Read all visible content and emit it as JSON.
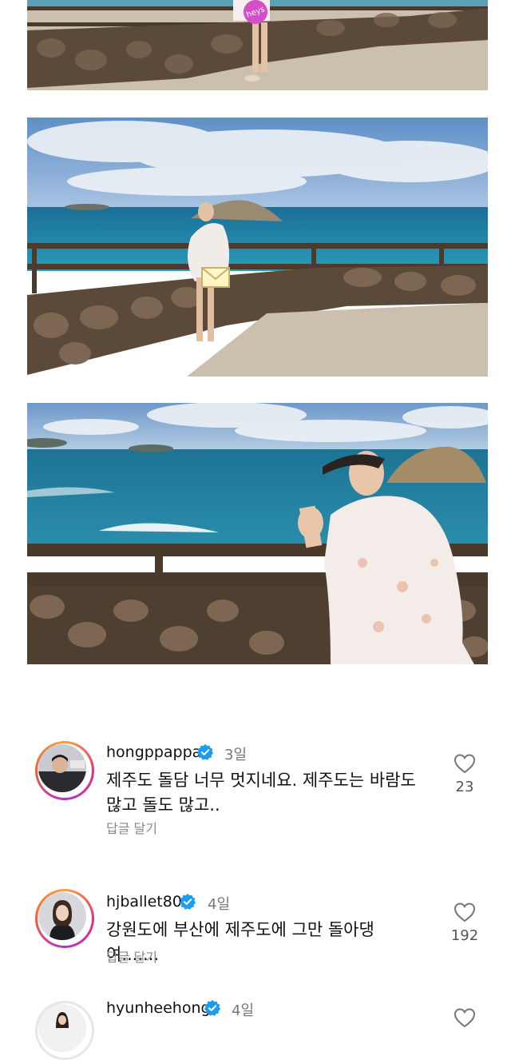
{
  "photos": [
    {
      "label": "photo-top-partial",
      "sticker_text": "heys"
    },
    {
      "label": "photo-middle"
    },
    {
      "label": "photo-bottom"
    }
  ],
  "comments": [
    {
      "username": "hongppappa",
      "time": "3일",
      "text_line1": "제주도 돌담 너무 멋지네요. 제주도는 바람도",
      "text_line2": "많고 돌도 많고..",
      "reply": "답글 달기",
      "likes": "23",
      "avatar_icon": "avatar-man-icon"
    },
    {
      "username": "hjballet80",
      "time": "4일",
      "text_line1": "강원도에 부산에 제주도에 그만 돌아댕여.......",
      "reply": "답글 달기",
      "likes": "192",
      "avatar_icon": "avatar-woman-icon"
    },
    {
      "username": "hyunheehong",
      "time": "4일",
      "avatar_icon": "avatar-woman-dark-icon"
    }
  ],
  "colors": {
    "verified": "#1d9bf0",
    "sky": "#7ea9d8",
    "sea": "#1e7fa3",
    "stone": "#5b4a3a",
    "path": "#cbbfae"
  }
}
